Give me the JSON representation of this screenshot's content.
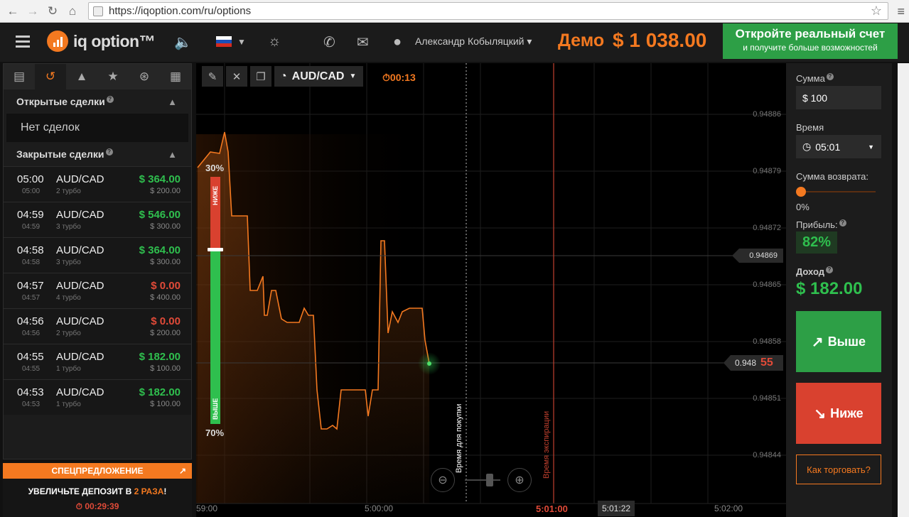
{
  "browser": {
    "url": "https://iqoption.com/ru/options",
    "back_icon": "arrow-left",
    "forward_icon": "arrow-right",
    "reload_icon": "reload",
    "home_icon": "home"
  },
  "header": {
    "logo_text": "iq option™",
    "user_name": "Александр Кобыляцкий",
    "mode": "Демо",
    "balance": "$ 1 038.00",
    "real_account_title": "Откройте реальный счет",
    "real_account_subtitle": "и получите больше возможностей"
  },
  "left_panel": {
    "open_deals_title": "Открытые сделки",
    "no_deals": "Нет сделок",
    "closed_deals_title": "Закрытые сделки",
    "deals": [
      {
        "time": "05:00",
        "time_small": "05:00",
        "pair": "AUD/CAD",
        "type": "2 турбо",
        "result": "$ 364.00",
        "stake": "$ 200.00",
        "win": true
      },
      {
        "time": "04:59",
        "time_small": "04:59",
        "pair": "AUD/CAD",
        "type": "3 турбо",
        "result": "$ 546.00",
        "stake": "$ 300.00",
        "win": true
      },
      {
        "time": "04:58",
        "time_small": "04:58",
        "pair": "AUD/CAD",
        "type": "3 турбо",
        "result": "$ 364.00",
        "stake": "$ 300.00",
        "win": true
      },
      {
        "time": "04:57",
        "time_small": "04:57",
        "pair": "AUD/CAD",
        "type": "4 турбо",
        "result": "$ 0.00",
        "stake": "$ 400.00",
        "win": false
      },
      {
        "time": "04:56",
        "time_small": "04:56",
        "pair": "AUD/CAD",
        "type": "2 турбо",
        "result": "$ 0.00",
        "stake": "$ 200.00",
        "win": false
      },
      {
        "time": "04:55",
        "time_small": "04:55",
        "pair": "AUD/CAD",
        "type": "1 турбо",
        "result": "$ 182.00",
        "stake": "$ 100.00",
        "win": true
      },
      {
        "time": "04:53",
        "time_small": "04:53",
        "pair": "AUD/CAD",
        "type": "1 турбо",
        "result": "$ 182.00",
        "stake": "$ 100.00",
        "win": true
      }
    ],
    "promo_title": "СПЕЦПРЕДЛОЖЕНИЕ",
    "promo_text_a": "УВЕЛИЧЬТЕ ДЕПОЗИТ В ",
    "promo_text_b": "2 РАЗА",
    "promo_text_c": "!",
    "promo_timer": "00:29:39"
  },
  "chart": {
    "asset": "AUD/CAD",
    "timer": "00:13",
    "pct_top": "30%",
    "pct_bottom": "70%",
    "lower_label": "НИЖЕ",
    "higher_label": "ВЫШЕ",
    "purchase_time_label": "Время для покупки",
    "expiration_label": "Время экспирации",
    "price_levels": [
      "0.94886",
      "0.94879",
      "0.94872",
      "0.94865",
      "0.94858",
      "0.94851",
      "0.94844"
    ],
    "line_price": "0.94869",
    "current_price_main": "0.948",
    "current_price_tail": "55",
    "time_labels": [
      "59:00",
      "5:00:00",
      "5:01:00",
      "5:01:22",
      "5:02:00"
    ],
    "bar_lower_fraction": 0.3
  },
  "right_panel": {
    "amount_label": "Сумма",
    "amount_value": "$ 100",
    "time_label": "Время",
    "time_value": "05:01",
    "return_label": "Сумма возврата:",
    "return_value": "0%",
    "profit_label": "Прибыль:",
    "profit_value": "82%",
    "income_label": "Доход",
    "income_value": "$ 182.00",
    "higher_btn": "Выше",
    "lower_btn": "Ниже",
    "howto_btn": "Как торговать?"
  },
  "colors": {
    "accent": "#f47920",
    "green": "#2fbf4e",
    "red": "#e04a38"
  }
}
